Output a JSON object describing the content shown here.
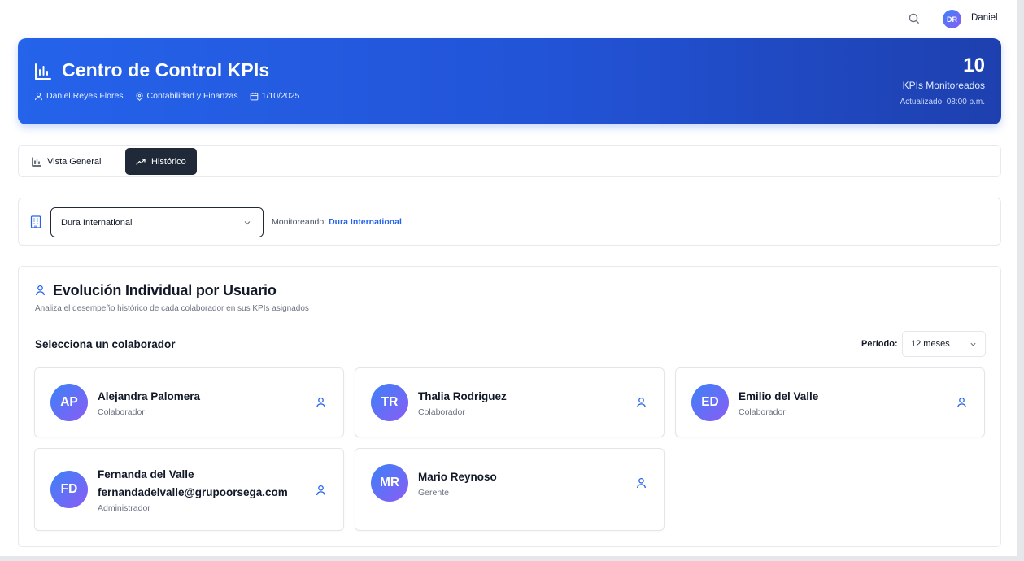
{
  "topbar": {
    "avatar_initials": "DR",
    "username": "Daniel"
  },
  "hero": {
    "title": "Centro de Control KPIs",
    "user": "Daniel Reyes Flores",
    "department": "Contabilidad y Finanzas",
    "date": "1/10/2025",
    "kpi_count": "10",
    "kpi_label": "KPIs Monitoreados",
    "updated": "Actualizado: 08:00 p.m."
  },
  "tabs": [
    {
      "label": "Vista General",
      "active": false
    },
    {
      "label": "Histórico",
      "active": true
    }
  ],
  "company": {
    "selected": "Dura International",
    "monitor_prefix": "Monitoreando:",
    "monitor_value": "Dura International"
  },
  "evolution": {
    "title": "Evolución Individual por Usuario",
    "subtitle": "Analiza el desempeño histórico de cada colaborador en sus KPIs asignados",
    "select_label": "Selecciona un colaborador",
    "period_label": "Período:",
    "period_value": "12 meses",
    "users": [
      {
        "initials": "AP",
        "name": "Alejandra Palomera",
        "email": "",
        "role": "Colaborador"
      },
      {
        "initials": "TR",
        "name": "Thalia Rodriguez",
        "email": "",
        "role": "Colaborador"
      },
      {
        "initials": "ED",
        "name": "Emilio del Valle",
        "email": "",
        "role": "Colaborador"
      },
      {
        "initials": "FD",
        "name": "Fernanda del Valle",
        "email": "fernandadelvalle@grupoorsega.com",
        "role": "Administrador"
      },
      {
        "initials": "MR",
        "name": "Mario Reynoso",
        "email": "",
        "role": "Gerente"
      }
    ]
  },
  "colors": {
    "accent": "#2563eb",
    "dark": "#1f2937",
    "avatar_from": "#3b82f6",
    "avatar_to": "#8b5cf6"
  },
  "icons": [
    "search-icon",
    "bar-chart-icon",
    "user-icon",
    "map-pin-icon",
    "calendar-icon",
    "trending-up-icon",
    "building-icon",
    "chevron-down-icon"
  ]
}
